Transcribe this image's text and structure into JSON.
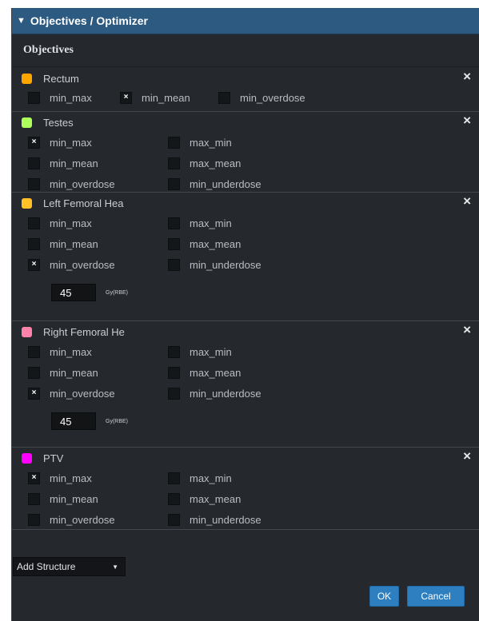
{
  "panel": {
    "collapse_icon": "triangle-down",
    "title": "Objectives / Optimizer",
    "section_title": "Objectives"
  },
  "structures": [
    {
      "name": "Rectum",
      "color": "#ffa500",
      "options": [
        {
          "label": "min_max",
          "checked": false
        },
        {
          "label": "min_mean",
          "checked": true
        },
        {
          "label": "min_overdose",
          "checked": false
        }
      ]
    },
    {
      "name": "Testes",
      "color": "#adff5c",
      "options": [
        {
          "label": "min_max",
          "checked": true
        },
        {
          "label": "max_min",
          "checked": false
        },
        {
          "label": "min_mean",
          "checked": false
        },
        {
          "label": "max_mean",
          "checked": false
        },
        {
          "label": "min_overdose",
          "checked": false
        },
        {
          "label": "min_underdose",
          "checked": false
        }
      ]
    },
    {
      "name": "Left Femoral Hea",
      "color": "#ffc125",
      "options": [
        {
          "label": "min_max",
          "checked": false
        },
        {
          "label": "max_min",
          "checked": false
        },
        {
          "label": "min_mean",
          "checked": false
        },
        {
          "label": "max_mean",
          "checked": false
        },
        {
          "label": "min_overdose",
          "checked": true
        },
        {
          "label": "min_underdose",
          "checked": false
        }
      ],
      "dose": {
        "value": "45",
        "unit": "Gy(RBE)"
      }
    },
    {
      "name": "Right Femoral He",
      "color": "#ff82ab",
      "options": [
        {
          "label": "min_max",
          "checked": false
        },
        {
          "label": "max_min",
          "checked": false
        },
        {
          "label": "min_mean",
          "checked": false
        },
        {
          "label": "max_mean",
          "checked": false
        },
        {
          "label": "min_overdose",
          "checked": true
        },
        {
          "label": "min_underdose",
          "checked": false
        }
      ],
      "dose": {
        "value": "45",
        "unit": "Gy(RBE)"
      }
    },
    {
      "name": "PTV",
      "color": "#ff00ff",
      "options": [
        {
          "label": "min_max",
          "checked": true
        },
        {
          "label": "max_min",
          "checked": false
        },
        {
          "label": "min_mean",
          "checked": false
        },
        {
          "label": "max_mean",
          "checked": false
        },
        {
          "label": "min_overdose",
          "checked": false
        },
        {
          "label": "min_underdose",
          "checked": false
        }
      ]
    }
  ],
  "check_glyph": "×",
  "close_glyph": "×",
  "add_structure": {
    "label": "Add Structure",
    "caret": "▼"
  },
  "buttons": {
    "ok": "OK",
    "cancel": "Cancel"
  }
}
